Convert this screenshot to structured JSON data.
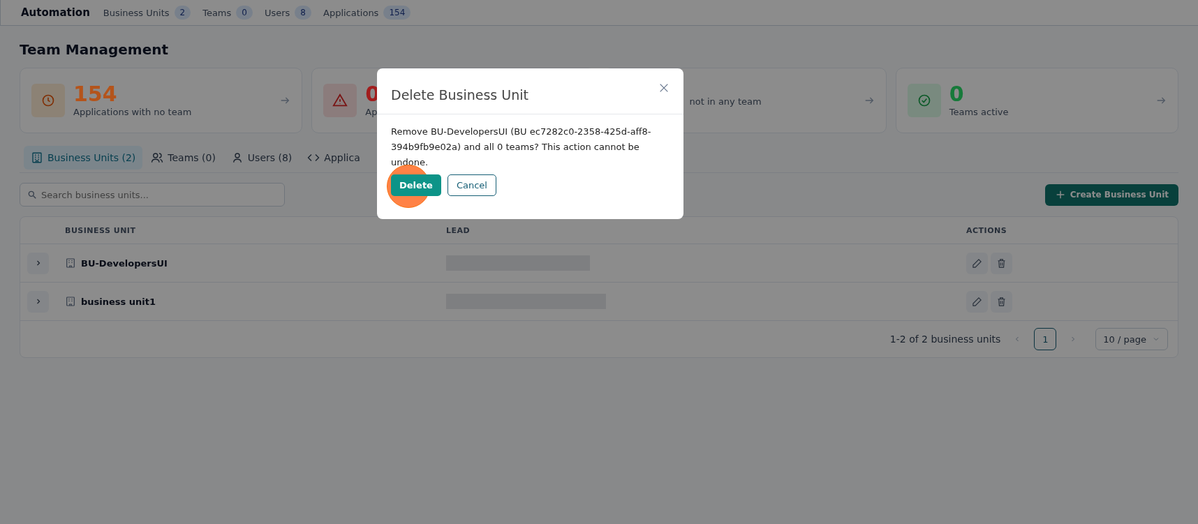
{
  "topbar": {
    "title": "Automation",
    "counts": [
      {
        "label": "Business Units",
        "count": "2"
      },
      {
        "label": "Teams",
        "count": "0"
      },
      {
        "label": "Users",
        "count": "8"
      },
      {
        "label": "Applications",
        "count": "154"
      }
    ]
  },
  "page_title": "Team Management",
  "stats": [
    {
      "kind": "clock",
      "value": "154",
      "label": "Applications with no team",
      "color": "#b4541b",
      "arrow": true
    },
    {
      "kind": "warning",
      "value": "0",
      "label": "Ap",
      "color": "#a11d1d",
      "arrow": false
    },
    {
      "kind": "hidden",
      "label": "not in any team",
      "arrow": true
    },
    {
      "kind": "check",
      "value": "0",
      "label": "Teams active",
      "color": "#177a3a",
      "arrow": true
    }
  ],
  "tabs": [
    {
      "kind": "building",
      "label": "Business Units (2)",
      "selected": true
    },
    {
      "kind": "people",
      "label": "Teams (0)",
      "selected": false
    },
    {
      "kind": "person",
      "label": "Users (8)",
      "selected": false
    },
    {
      "kind": "code",
      "label": "Applica",
      "selected": false
    }
  ],
  "search": {
    "placeholder": "Search business units..."
  },
  "create_button": "Create Business Unit",
  "table": {
    "columns": [
      "BUSINESS UNIT",
      "LEAD",
      "ACTIONS"
    ],
    "rows": [
      {
        "name": "BU-DevelopersUI",
        "expanded": false
      },
      {
        "name": "business unit1",
        "expanded": false
      }
    ]
  },
  "pagination": {
    "summary": "1-2 of 2 business units",
    "pages": [
      {
        "label": "1",
        "selected": true
      }
    ],
    "page_size": "10 / page"
  },
  "dialog": {
    "title": "Delete Business Unit",
    "message": "Remove BU-DevelopersUI (BU ec7282c0-2358-425d-aff8-394b9fb9e02a) and all 0 teams? This action cannot be undone.",
    "confirm": "Delete",
    "cancel": "Cancel"
  }
}
